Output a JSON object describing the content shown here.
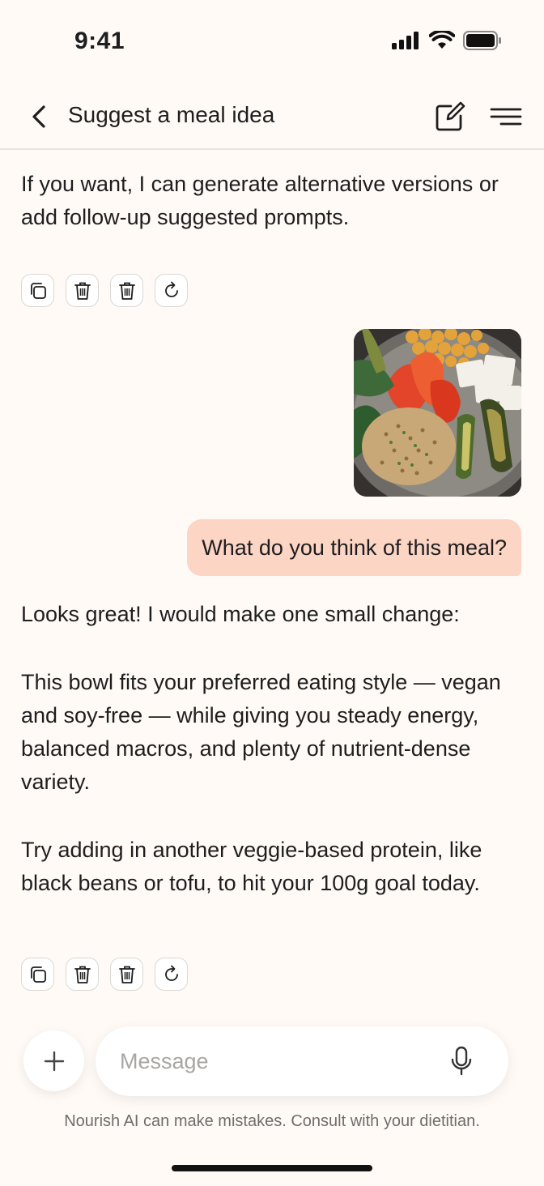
{
  "status": {
    "time": "9:41"
  },
  "header": {
    "title": "Suggest a meal idea"
  },
  "messages": {
    "assistant_1": "If you want, I can generate alternative versions or add follow-up suggested prompts.",
    "user_1": "What do you think of this meal?",
    "assistant_2_p1": "Looks great! I would make one small change:",
    "assistant_2_p2": "This bowl fits your preferred eating style — vegan and soy-free — while giving you steady energy, balanced macros, and plenty of nutrient-dense variety.",
    "assistant_2_p3": "Try adding in another veggie-based protein, like black beans or tofu, to hit your 100g goal today."
  },
  "composer": {
    "placeholder": "Message"
  },
  "footer": {
    "disclaimer": "Nourish AI can make mistakes. Consult with your dietitian."
  },
  "icons": {
    "back": "chevron-left-icon",
    "new_chat": "edit-icon",
    "menu": "menu-icon",
    "copy": "copy-icon",
    "delete": "trash-icon",
    "regenerate": "refresh-icon",
    "plus": "plus-icon",
    "mic": "microphone-icon"
  },
  "colors": {
    "background": "#FFFAF6",
    "user_bubble": "#FCD5C5",
    "text": "#1E1E1E"
  }
}
